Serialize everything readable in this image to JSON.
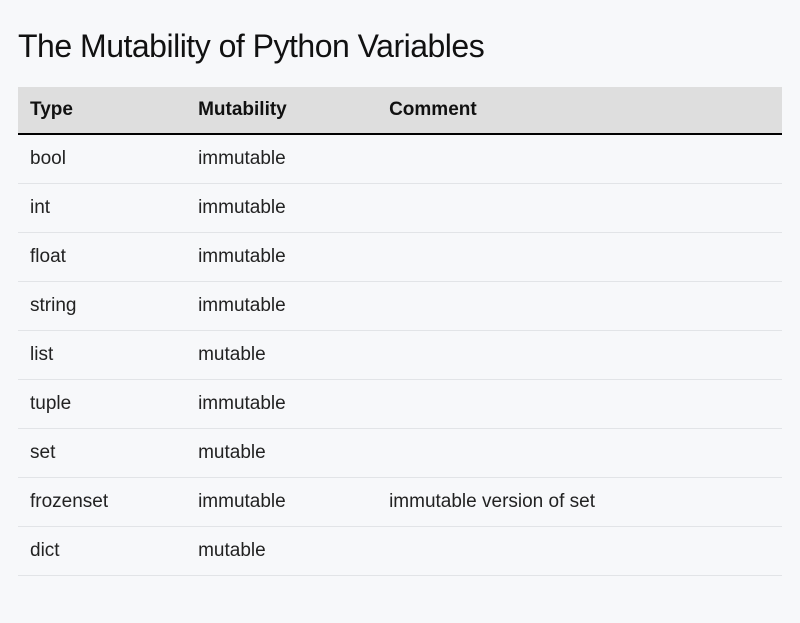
{
  "title": "The Mutability of Python Variables",
  "chart_data": {
    "type": "table",
    "columns": [
      "Type",
      "Mutability",
      "Comment"
    ],
    "rows": [
      {
        "type": "bool",
        "mutability": "immutable",
        "comment": ""
      },
      {
        "type": "int",
        "mutability": "immutable",
        "comment": ""
      },
      {
        "type": "float",
        "mutability": "immutable",
        "comment": ""
      },
      {
        "type": "string",
        "mutability": "immutable",
        "comment": ""
      },
      {
        "type": "list",
        "mutability": "mutable",
        "comment": ""
      },
      {
        "type": "tuple",
        "mutability": "immutable",
        "comment": ""
      },
      {
        "type": "set",
        "mutability": "mutable",
        "comment": ""
      },
      {
        "type": "frozenset",
        "mutability": "immutable",
        "comment": "immutable version of set"
      },
      {
        "type": "dict",
        "mutability": "mutable",
        "comment": ""
      }
    ]
  }
}
